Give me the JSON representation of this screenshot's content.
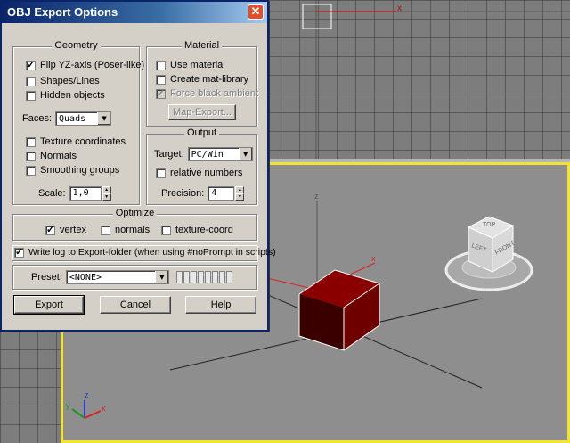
{
  "dialog": {
    "title": "OBJ Export Options",
    "close_glyph": "✕"
  },
  "geometry": {
    "title": "Geometry",
    "flip_yz": {
      "label": "Flip YZ-axis (Poser-like)",
      "checked": true
    },
    "shapes_lines": {
      "label": "Shapes/Lines",
      "checked": false
    },
    "hidden_objects": {
      "label": "Hidden objects",
      "checked": false
    },
    "faces_label": "Faces:",
    "faces_value": "Quads",
    "texture_coords": {
      "label": "Texture coordinates",
      "checked": false
    },
    "normals": {
      "label": "Normals",
      "checked": false
    },
    "smoothing_groups": {
      "label": "Smoothing groups",
      "checked": false
    },
    "scale_label": "Scale:",
    "scale_value": "1,0"
  },
  "material": {
    "title": "Material",
    "use_material": {
      "label": "Use material",
      "checked": false
    },
    "create_mat_library": {
      "label": "Create mat-library",
      "checked": false
    },
    "force_black_ambient": {
      "label": "Force black ambient",
      "checked": true,
      "disabled": true
    },
    "map_export_label": "Map-Export..."
  },
  "output": {
    "title": "Output",
    "target_label": "Target:",
    "target_value": "PC/Win",
    "relative_numbers": {
      "label": "relative numbers",
      "checked": false
    },
    "precision_label": "Precision:",
    "precision_value": "4"
  },
  "optimize": {
    "title": "Optimize",
    "vertex": {
      "label": "vertex",
      "checked": true
    },
    "normals": {
      "label": "normals",
      "checked": false
    },
    "texture_coord": {
      "label": "texture-coord",
      "checked": false
    }
  },
  "write_log": {
    "label": "Write log to Export-folder (when using #noPrompt in scripts)",
    "checked": true
  },
  "preset": {
    "label": "Preset:",
    "value": "<NONE>"
  },
  "buttons": {
    "export": "Export",
    "cancel": "Cancel",
    "help": "Help"
  },
  "viewport": {
    "viewcube_top": "TOP",
    "viewcube_left": "LEFT",
    "viewcube_front": "FRONT",
    "axis_x": "x",
    "axis_y": "y",
    "axis_z": "z",
    "box_color": "#6e0000",
    "active_border_color": "#f2e236"
  }
}
